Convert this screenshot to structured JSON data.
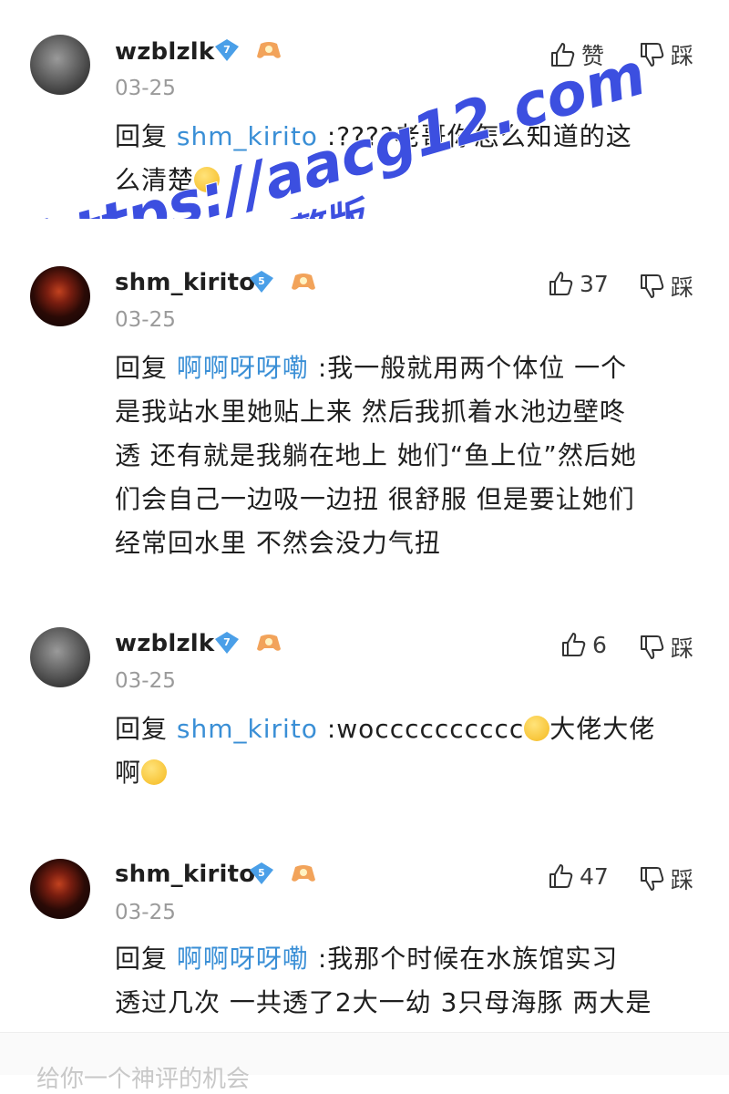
{
  "comments": [
    {
      "username": "wzblzlk",
      "level": "7",
      "date": "03-25",
      "like_label": "赞",
      "dislike_label": "踩",
      "reply_prefix": "回复",
      "mention": "shm_kirito",
      "text_lines": [
        ":????老哥你怎么知道的这",
        "么清楚"
      ],
      "avatar_style": "gray"
    },
    {
      "username": "shm_kirito",
      "level": "5",
      "date": "03-25",
      "like_label": "37",
      "dislike_label": "踩",
      "reply_prefix": "回复",
      "mention": "啊啊呀呀嘞",
      "text_lines": [
        ":我一般就用两个体位 一个",
        "是我站水里她贴上来 然后我抓着水池边壁咚",
        "透 还有就是我躺在地上 她们“鱼上位”然后她",
        "们会自己一边吸一边扭 很舒服 但是要让她们",
        "经常回水里 不然会没力气扭"
      ],
      "avatar_style": "dark"
    },
    {
      "username": "wzblzlk",
      "level": "7",
      "date": "03-25",
      "like_label": "6",
      "dislike_label": "踩",
      "reply_prefix": "回复",
      "mention": "shm_kirito",
      "text_lines": [
        ":wocccccccccc",
        "大佬大佬",
        "啊"
      ],
      "avatar_style": "gray"
    },
    {
      "username": "shm_kirito",
      "level": "5",
      "date": "03-25",
      "like_label": "47",
      "dislike_label": "踩",
      "reply_prefix": "回复",
      "mention": "啊啊呀呀嘞",
      "text_lines": [
        ":我那个时候在水族馆实习",
        "透过几次 一共透了2大一幼 3只母海豚 两大是"
      ],
      "avatar_style": "dark"
    }
  ],
  "bottom_input_placeholder": "给你一个神评的机会",
  "watermark": {
    "line1": "https://aacg12.com",
    "line2": "看完整版"
  },
  "colors": {
    "mention": "#3a8fd6",
    "vip_badge": "#4a9fe8",
    "watermark": "#3c4fe0",
    "date": "#9a9a9a"
  }
}
